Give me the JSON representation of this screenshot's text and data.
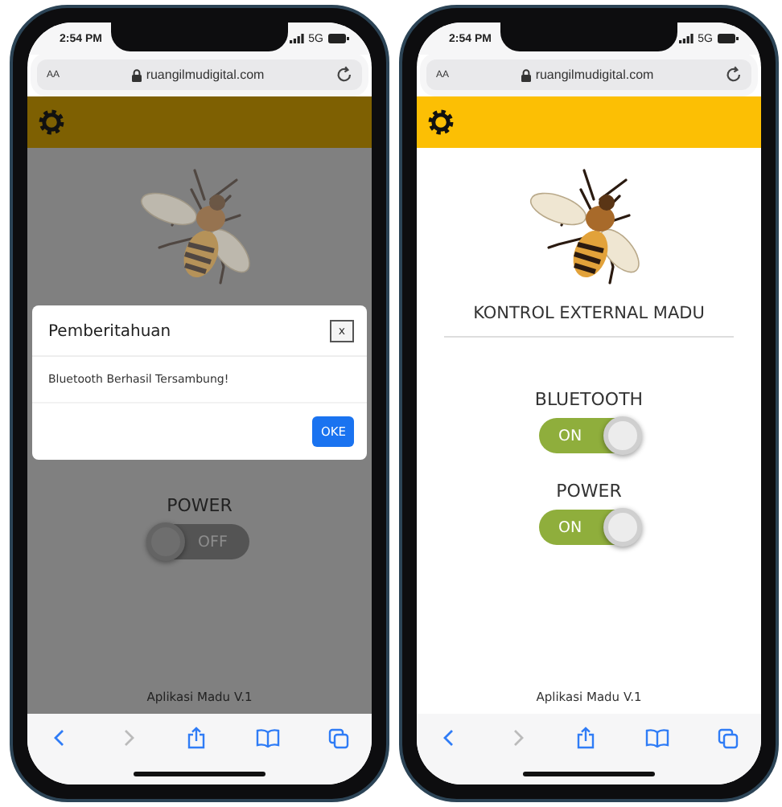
{
  "phones": [
    {
      "status": {
        "time": "2:54 PM",
        "network": "5G"
      },
      "browser": {
        "text_size": "AA",
        "url": "ruangilmudigital.com"
      },
      "page": {
        "dimmed": true,
        "controls": [
          {
            "label": "POWER",
            "on": false,
            "state_text": "OFF"
          }
        ],
        "footer": "Aplikasi Madu V.1"
      },
      "dialog": {
        "title": "Pemberitahuan",
        "close": "x",
        "message": "Bluetooth Berhasil Tersambung!",
        "button": "OKE"
      },
      "toolbar": [
        {
          "kind": "back",
          "disabled": false
        },
        {
          "kind": "forward",
          "disabled": true
        },
        {
          "kind": "share",
          "disabled": false
        },
        {
          "kind": "bookmarks",
          "disabled": false
        },
        {
          "kind": "tabs",
          "disabled": false
        }
      ]
    },
    {
      "status": {
        "time": "2:54 PM",
        "network": "5G"
      },
      "browser": {
        "text_size": "AA",
        "url": "ruangilmudigital.com"
      },
      "page": {
        "dimmed": false,
        "title": "KONTROL EXTERNAL MADU",
        "controls": [
          {
            "label": "BLUETOOTH",
            "on": true,
            "state_text": "ON"
          },
          {
            "label": "POWER",
            "on": true,
            "state_text": "ON"
          }
        ],
        "footer": "Aplikasi Madu V.1"
      },
      "toolbar": [
        {
          "kind": "back",
          "disabled": false
        },
        {
          "kind": "forward",
          "disabled": true
        },
        {
          "kind": "share",
          "disabled": false
        },
        {
          "kind": "bookmarks",
          "disabled": false
        },
        {
          "kind": "tabs",
          "disabled": false
        }
      ]
    }
  ]
}
